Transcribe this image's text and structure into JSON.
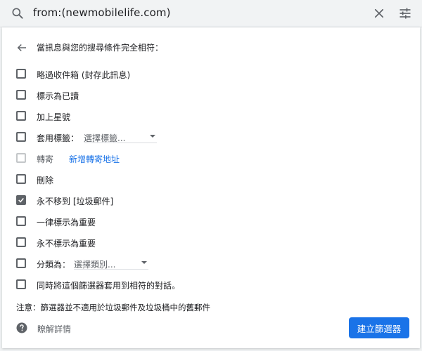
{
  "search": {
    "query": "from:(newmobilelife.com)"
  },
  "colors": {
    "accent": "#1a73e8",
    "checkbox_border": "#5f6368"
  },
  "icons": {
    "search": "search-icon",
    "close": "close-icon",
    "tune": "tune-icon",
    "back": "arrow-back-icon",
    "help": "help-icon"
  },
  "filter": {
    "header": "當訊息與您的搜尋條件完全相符：",
    "options": [
      {
        "label": "略過收件箱 (封存此訊息)",
        "checked": false
      },
      {
        "label": "標示為已讀",
        "checked": false
      },
      {
        "label": "加上星號",
        "checked": false
      },
      {
        "label": "套用標籤：",
        "checked": false,
        "select_value": "選擇標籤..."
      },
      {
        "label": "轉寄",
        "checked": false,
        "disabled": true,
        "link": "新增轉寄地址"
      },
      {
        "label": "刪除",
        "checked": false
      },
      {
        "label": "永不移到 [垃圾郵件]",
        "checked": true
      },
      {
        "label": "一律標示為重要",
        "checked": false
      },
      {
        "label": "永不標示為重要",
        "checked": false
      },
      {
        "label": "分類為：",
        "checked": false,
        "select_value": "選擇類別..."
      },
      {
        "label": "同時將這個篩選器套用到相符的對話。",
        "checked": false
      }
    ],
    "note": "注意：篩選器並不適用於垃圾郵件及垃圾桶中的舊郵件",
    "help_label": "瞭解詳情",
    "create_button": "建立篩選器"
  }
}
